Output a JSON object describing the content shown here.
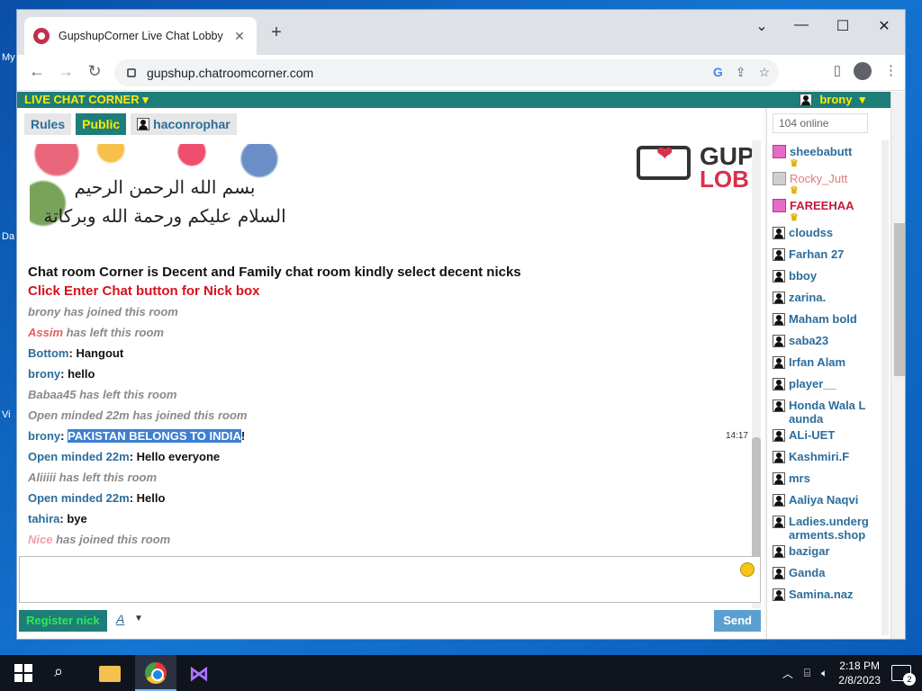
{
  "desktop": {
    "labels": [
      "My",
      "Da",
      "Vi"
    ]
  },
  "browser": {
    "tab_title": "GupshupCorner Live Chat Lobby",
    "url": "gupshup.chatroomcorner.com"
  },
  "site": {
    "brand": "LIVE CHAT CORNER",
    "current_user": "brony",
    "tabs": [
      "Rules",
      "Public",
      "haconrophar"
    ],
    "banner_right_line1": "GUP",
    "banner_right_line2": "LOB",
    "online_count": "104 online",
    "register_label": "Register nick",
    "font_label": "A",
    "send_label": "Send"
  },
  "messages": [
    {
      "type": "notice1",
      "text": "Chat room Corner is Decent and Family chat room kindly select decent nicks"
    },
    {
      "type": "notice2",
      "text": "Click Enter Chat button for Nick box"
    },
    {
      "type": "sys",
      "nick": "brony",
      "text": " has joined this room"
    },
    {
      "type": "sys-red",
      "nick": "Assim",
      "text": " has left this room"
    },
    {
      "type": "chat",
      "nick": "Bottom",
      "text": ": Hangout"
    },
    {
      "type": "chat",
      "nick": "brony",
      "text": ": hello"
    },
    {
      "type": "sys",
      "nick": "Babaa45",
      "text": " has left this room"
    },
    {
      "type": "sys",
      "nick": "Open minded 22m",
      "text": " has joined this room"
    },
    {
      "type": "chat-hl",
      "nick": "brony",
      "pre": ": ",
      "hl": "PAKISTAN BELONGS TO INDIA",
      "post": "!",
      "time": "14:17"
    },
    {
      "type": "chat",
      "nick": "Open minded 22m",
      "text": ": Hello everyone"
    },
    {
      "type": "sys",
      "nick": "Aliiiii",
      "text": " has left this room"
    },
    {
      "type": "chat",
      "nick": "Open minded 22m",
      "text": ": Hello"
    },
    {
      "type": "chat",
      "nick": "tahira",
      "text": ": bye"
    },
    {
      "type": "sys-pink",
      "nick": "Nice",
      "text": " has joined this room"
    }
  ],
  "users": [
    {
      "name": "sheebabutt",
      "kind": "female",
      "crown": true
    },
    {
      "name": "Rocky_Jutt",
      "kind": "pink",
      "crown": true
    },
    {
      "name": "FAREEHAA",
      "kind": "female-red",
      "crown": true
    },
    {
      "name": "cloudss",
      "kind": "user"
    },
    {
      "name": "Farhan 27",
      "kind": "user"
    },
    {
      "name": "bboy",
      "kind": "user"
    },
    {
      "name": "zarina.",
      "kind": "user"
    },
    {
      "name": "Maham bold",
      "kind": "user"
    },
    {
      "name": "saba23",
      "kind": "user"
    },
    {
      "name": "Irfan Alam",
      "kind": "user"
    },
    {
      "name": "player__",
      "kind": "user"
    },
    {
      "name": "Honda Wala Launda",
      "kind": "user"
    },
    {
      "name": "ALi-UET",
      "kind": "user"
    },
    {
      "name": "Kashmiri.F",
      "kind": "user"
    },
    {
      "name": "mrs",
      "kind": "user"
    },
    {
      "name": "Aaliya Naqvi",
      "kind": "user"
    },
    {
      "name": "Ladies.undergarments.shop",
      "kind": "user"
    },
    {
      "name": "bazigar",
      "kind": "user"
    },
    {
      "name": "Ganda",
      "kind": "user"
    },
    {
      "name": "Samina.naz",
      "kind": "user"
    }
  ],
  "taskbar": {
    "time": "2:18 PM",
    "date": "2/8/2023",
    "notifications": "2"
  }
}
